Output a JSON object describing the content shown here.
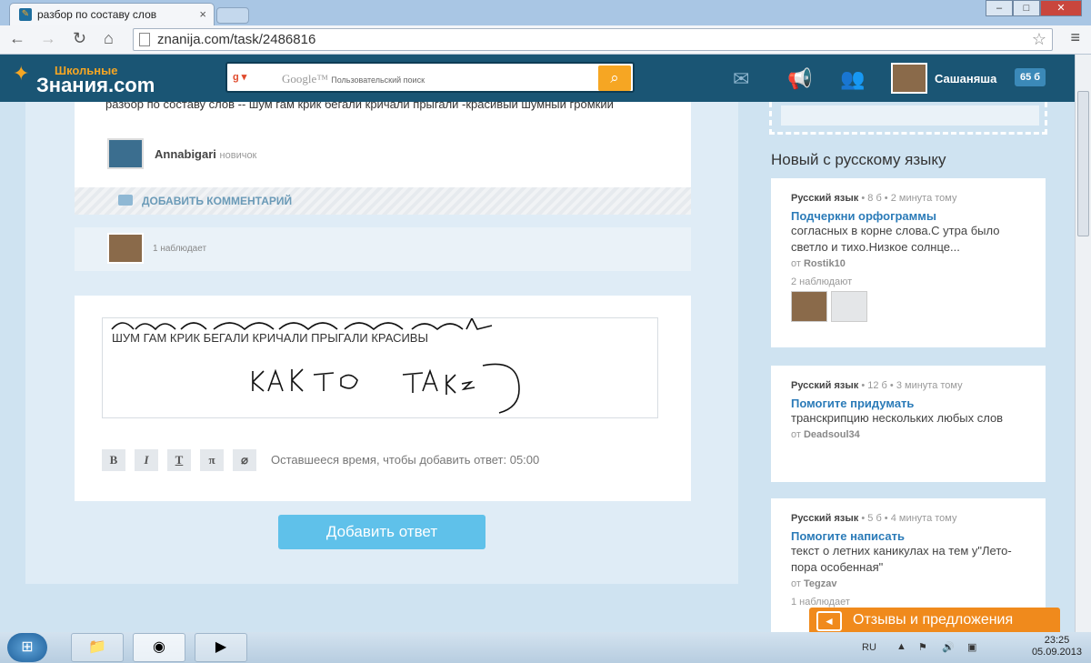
{
  "browser": {
    "tab_title": "разбор по составу слов",
    "url": "znanija.com/task/2486816"
  },
  "site": {
    "logo_top": "Школьные",
    "logo_main": "Знания.com",
    "search_brand": "Google™",
    "search_placeholder": "Пользовательский поиск",
    "username": "Сашаняша",
    "points": "65 б"
  },
  "question": {
    "text": "разбор по составу слов -- шум гам крик бегали кричали прыгали -красивый шумный громкий",
    "author": "Annabigari",
    "rank": "новичок",
    "add_comment": "ДОБАВИТЬ КОММЕНТАРИЙ",
    "observers": "1 наблюдает"
  },
  "answer": {
    "editor_text": "ШУМ ГАМ КРИК БЕГАЛИ КРИЧАЛИ ПРЫГАЛИ КРАСИВЫ",
    "handwriting": "как то так",
    "format_buttons": [
      "B",
      "I",
      "T",
      "π",
      "⌀"
    ],
    "time_left": "Оставшееся время, чтобы добавить ответ: 05:00",
    "submit": "Добавить ответ"
  },
  "sidebar": {
    "title": "Новый с русскому языку",
    "items": [
      {
        "subject": "Русский язык",
        "points": "8 б",
        "time": "2 минута тому",
        "title": "Подчеркни орфограммы",
        "desc": "согласных в корне слова.С утра было светло и тихо.Низкое солнце...",
        "from": "от",
        "author": "Rostik10",
        "observers": "2 наблюдают"
      },
      {
        "subject": "Русский язык",
        "points": "12 б",
        "time": "3 минута тому",
        "title": "Помогите придумать",
        "desc": "транскрипцию нескольких любых слов",
        "from": "от",
        "author": "Deadsoul34",
        "observers": ""
      },
      {
        "subject": "Русский язык",
        "points": "5 б",
        "time": "4 минута тому",
        "title": "Помогите написать",
        "desc": "текст о летних каникулах на тем у\"Лето-пора особенная\"",
        "from": "от",
        "author": "Tegzav",
        "observers": "1 наблюдает"
      }
    ]
  },
  "feedback": "Отзывы и предложения",
  "taskbar": {
    "lang": "RU",
    "time": "23:25",
    "date": "05.09.2013"
  }
}
